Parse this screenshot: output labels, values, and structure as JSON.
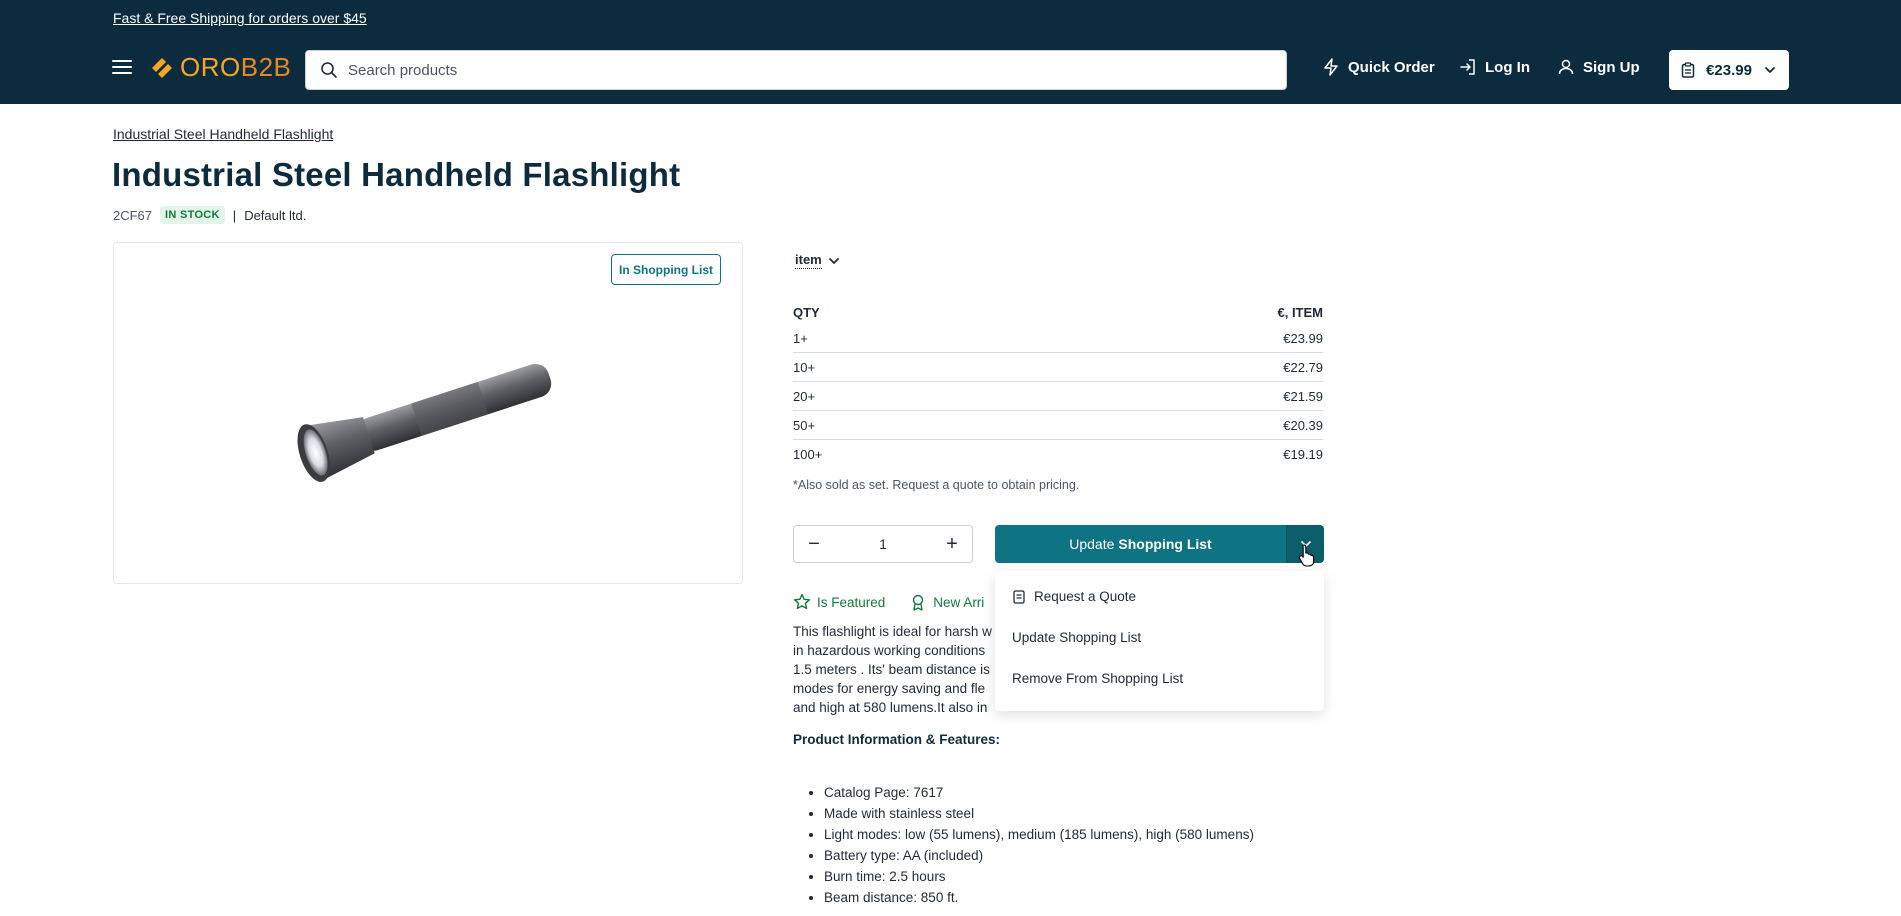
{
  "header": {
    "promo": "Fast & Free Shipping for orders over $45",
    "logo": {
      "part1": "ORO",
      "part2": "B2B"
    },
    "search_placeholder": "Search products",
    "quick_order": "Quick Order",
    "login": "Log In",
    "signup": "Sign Up",
    "cart_total": "€23.99",
    "colors": {
      "bg": "#0d2b3e",
      "accent": "#f5a623"
    }
  },
  "breadcrumb": "Industrial Steel Handheld Flashlight",
  "product": {
    "title": "Industrial Steel Handheld Flashlight",
    "sku": "2CF67",
    "stock": "IN STOCK",
    "separator": "|",
    "owner": "Default ltd.",
    "in_list_badge": "In Shopping List",
    "unit": "item"
  },
  "price_table": {
    "col_qty": "QTY",
    "col_price": "€, ITEM",
    "rows": [
      {
        "qty": "1+",
        "price": "€23.99"
      },
      {
        "qty": "10+",
        "price": "€22.79"
      },
      {
        "qty": "20+",
        "price": "€21.59"
      },
      {
        "qty": "50+",
        "price": "€20.39"
      },
      {
        "qty": "100+",
        "price": "€19.19"
      }
    ],
    "note": "*Also sold as set. Request a quote to obtain pricing."
  },
  "actions": {
    "quantity": "1",
    "minus": "−",
    "plus": "+",
    "update_prefix": "Update",
    "update_bold": "Shopping List",
    "accent": "#0e7383"
  },
  "dropdown": {
    "items": [
      "Request a Quote",
      "Update Shopping List",
      "Remove From Shopping List"
    ]
  },
  "labels": {
    "featured": "Is Featured",
    "new_arrival": "New Arri"
  },
  "description": {
    "lines": [
      "This flashlight is ideal for harsh w",
      "in hazardous working conditions",
      "1.5 meters . Its' beam distance is",
      "modes for energy saving and fle",
      "and high at 580 lumens.It also in"
    ]
  },
  "product_info": {
    "heading": "Product Information & Features:",
    "features": [
      "Catalog Page: 7617",
      "Made with stainless steel",
      "Light modes: low (55 lumens), medium (185 lumens), high (580 lumens)",
      "Battery type: AA (included)",
      "Burn time: 2.5 hours",
      "Beam distance: 850 ft."
    ]
  }
}
